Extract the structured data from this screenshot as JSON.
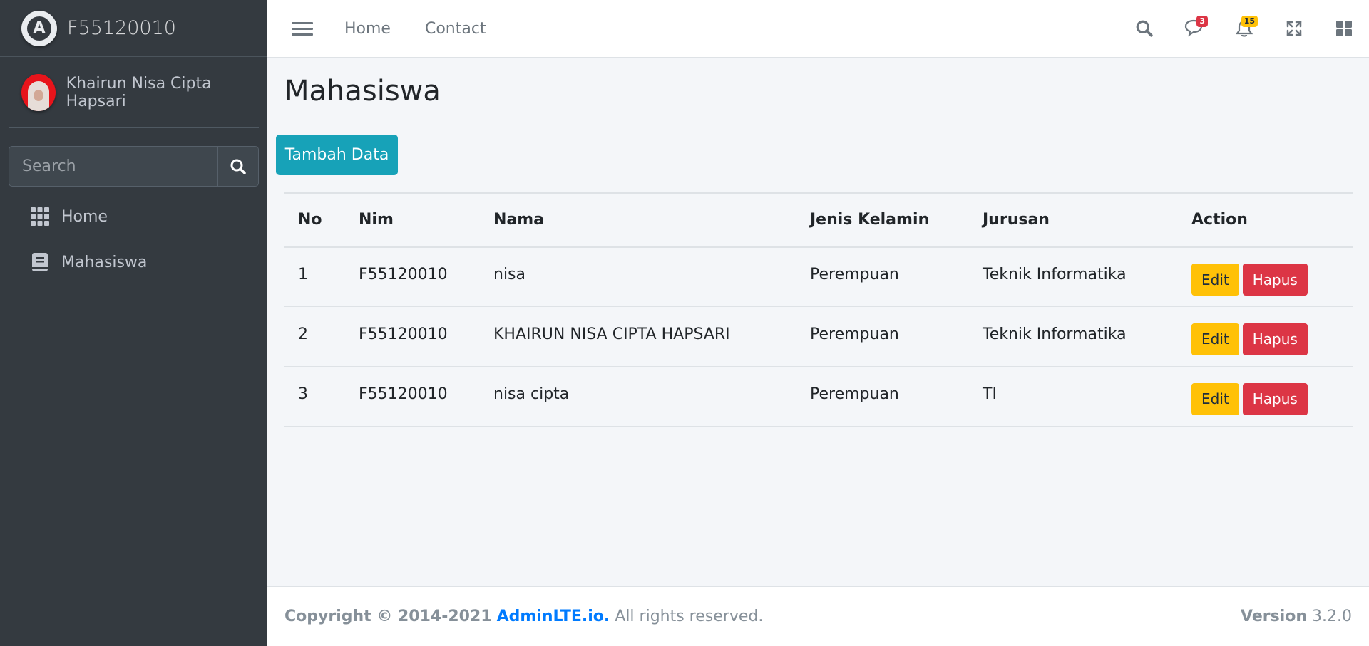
{
  "brand": {
    "title": "F55120010"
  },
  "user": {
    "name": "Khairun Nisa Cipta Hapsari"
  },
  "sidebar_search": {
    "placeholder": "Search"
  },
  "sidebar": {
    "items": [
      {
        "label": "Home",
        "icon": "grid-icon"
      },
      {
        "label": "Mahasiswa",
        "icon": "book-icon"
      }
    ]
  },
  "topnav": {
    "links": [
      "Home",
      "Contact"
    ],
    "messages_badge": "3",
    "notifications_badge": "15",
    "colors": {
      "danger": "#dc3545",
      "warning": "#ffc107"
    }
  },
  "main": {
    "title": "Mahasiswa",
    "add_button": "Tambah Data",
    "table": {
      "headers": [
        "No",
        "Nim",
        "Nama",
        "Jenis Kelamin",
        "Jurusan",
        "Action"
      ],
      "rows": [
        {
          "no": "1",
          "nim": "F55120010",
          "nama": "nisa",
          "jk": "Perempuan",
          "jurusan": "Teknik Informatika"
        },
        {
          "no": "2",
          "nim": "F55120010",
          "nama": "KHAIRUN NISA CIPTA HAPSARI",
          "jk": "Perempuan",
          "jurusan": "Teknik Informatika"
        },
        {
          "no": "3",
          "nim": "F55120010",
          "nama": "nisa cipta",
          "jk": "Perempuan",
          "jurusan": "TI"
        }
      ],
      "edit_label": "Edit",
      "delete_label": "Hapus"
    }
  },
  "footer": {
    "copyright": "Copyright © 2014-2021",
    "link": "AdminLTE.io.",
    "rights": "All rights reserved.",
    "version_label": "Version",
    "version": "3.2.0"
  }
}
